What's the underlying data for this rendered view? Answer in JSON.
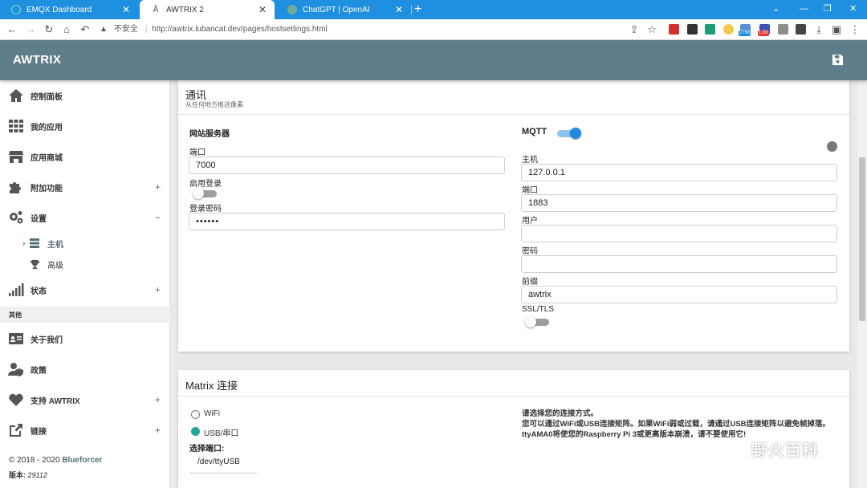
{
  "browser": {
    "tabs": [
      {
        "title": "EMQX Dashboard",
        "active": false
      },
      {
        "title": "AWTRIX 2",
        "active": true
      },
      {
        "title": "ChatGPT | OpenAI",
        "active": false
      }
    ],
    "new_tab": "+",
    "security_label": "不安全",
    "url": "http://awtrix.lubancat.dev/pages/hostsettings.html",
    "ext_badge_1": "2768",
    "ext_badge_2": "1.00"
  },
  "app": {
    "title": "AWTRIX"
  },
  "sidebar": {
    "items": [
      {
        "label": "控制面板",
        "icon": "home-icon"
      },
      {
        "label": "我的应用",
        "icon": "grid-icon"
      },
      {
        "label": "应用商城",
        "icon": "store-icon"
      },
      {
        "label": "附加功能",
        "icon": "puzzle-icon",
        "expand": "+"
      },
      {
        "label": "设置",
        "icon": "gears-icon",
        "expand": "−"
      },
      {
        "label": "状态",
        "icon": "signal-icon",
        "expand": "+"
      }
    ],
    "sub_items": [
      {
        "label": "主机",
        "icon": "server-icon"
      },
      {
        "label": "高级",
        "icon": "trophy-icon"
      }
    ],
    "section": "其他",
    "other_items": [
      {
        "label": "关于我们",
        "icon": "id-card-icon"
      },
      {
        "label": "政策",
        "icon": "user-shield-icon"
      },
      {
        "label": "支持 AWTRIX",
        "icon": "heart-icon",
        "expand": "+"
      },
      {
        "label": "链接",
        "icon": "external-link-icon",
        "expand": "+"
      }
    ],
    "footer_copyright": "© 2018 - 2020 ",
    "footer_author": "Blueforcer",
    "footer_version_label": "版本: ",
    "footer_version": "29112"
  },
  "comm": {
    "title": "通讯",
    "subtitle": "从任何地方推送像素",
    "webserver": {
      "heading": "网站服务器",
      "port_label": "端口",
      "port_value": "7000",
      "login_label": "启用登录",
      "login_enabled": false,
      "password_label": "登录密码",
      "password_value": "••••••"
    },
    "mqtt": {
      "heading": "MQTT",
      "enabled": true,
      "host_label": "主机",
      "host_value": "127.0.0.1",
      "port_label": "端口",
      "port_value": "1883",
      "user_label": "用户",
      "user_value": "",
      "password_label": "密码",
      "password_value": "",
      "prefix_label": "前缀",
      "prefix_value": "awtrix",
      "ssl_label": "SSL/TLS",
      "ssl_enabled": false
    }
  },
  "matrix": {
    "title": "Matrix 连接",
    "options": [
      {
        "label": "WiFi",
        "selected": false
      },
      {
        "label": "USB/串口",
        "selected": true
      }
    ],
    "port_select_label": "选择端口:",
    "port_select_value": "/dev/ttyUSB",
    "description": "请选择您的连接方式。\n您可以通过WiFi或USB连接矩阵。如果WiFi弱或过载，请通过USB连接矩阵以避免帧掉落。ttyAMA0将使您的Raspberry Pi 3或更高版本崩溃，请不要使用它!"
  },
  "watermark": "野火百科",
  "colors": {
    "tabbar": "#1f8fe0",
    "header": "#607d8b",
    "toggle_on": "#1e88e5",
    "radio_on": "#26a69a"
  }
}
